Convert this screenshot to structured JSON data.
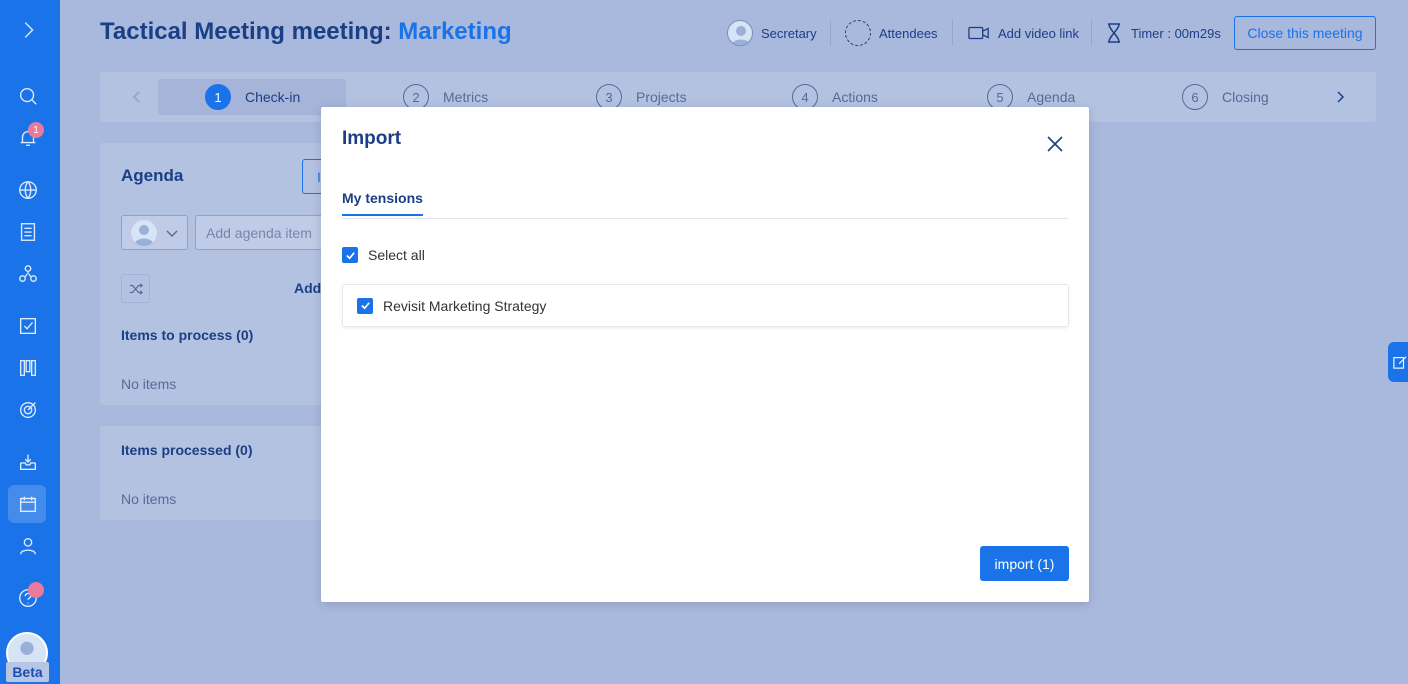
{
  "header": {
    "title_prefix": "Tactical Meeting meeting:",
    "title_circle": "Marketing",
    "secretary_label": "Secretary",
    "attendees_label": "Attendees",
    "video_label": "Add video link",
    "timer_label": "Timer : 00m29s",
    "close_button": "Close this meeting"
  },
  "steps": [
    {
      "num": "1",
      "label": "Check-in"
    },
    {
      "num": "2",
      "label": "Metrics"
    },
    {
      "num": "3",
      "label": "Projects"
    },
    {
      "num": "4",
      "label": "Actions"
    },
    {
      "num": "5",
      "label": "Agenda"
    },
    {
      "num": "6",
      "label": "Closing"
    }
  ],
  "sidebar": {
    "notification_count": "1",
    "beta_label": "Beta"
  },
  "agenda": {
    "title": "Agenda",
    "import_button_partial": "I",
    "add_placeholder": "Add agenda item",
    "add_link_partial": "Add",
    "to_process_label": "Items to process (0)",
    "processed_label": "Items processed (0)",
    "no_items": "No items"
  },
  "modal": {
    "title": "Import",
    "tab_label": "My tensions",
    "select_all": "Select all",
    "tension_item": "Revisit Marketing Strategy",
    "import_button": "import (1)"
  }
}
